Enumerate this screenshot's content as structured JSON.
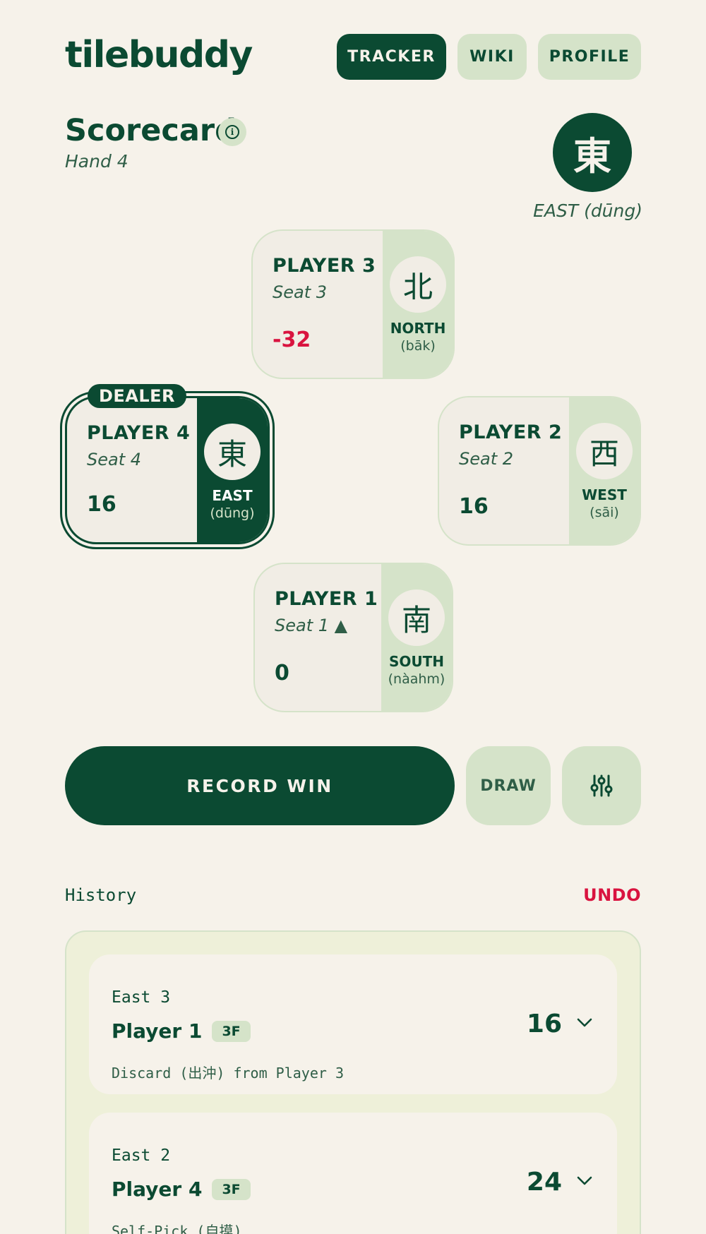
{
  "header": {
    "logo": "tilebuddy",
    "nav": [
      {
        "label": "TRACKER",
        "active": true
      },
      {
        "label": "WIKI",
        "active": false
      },
      {
        "label": "PROFILE",
        "active": false
      }
    ]
  },
  "scorecard": {
    "title": "Scorecard",
    "info_icon": "info-icon",
    "hand": "Hand 4",
    "prevailing_wind": {
      "tile": "東",
      "label": "EAST (dūng)"
    }
  },
  "players": {
    "top": {
      "name": "PLAYER 3",
      "seat": "Seat 3",
      "score": "-32",
      "tile": "北",
      "wind": "NORTH",
      "romanization": "(bāk)"
    },
    "left": {
      "name": "PLAYER 4",
      "seat": "Seat 4",
      "score": "16",
      "tile": "東",
      "wind": "EAST",
      "romanization": "(dūng)",
      "badge": "DEALER"
    },
    "right": {
      "name": "PLAYER 2",
      "seat": "Seat 2",
      "score": "16",
      "tile": "西",
      "wind": "WEST",
      "romanization": "(sāi)"
    },
    "bottom": {
      "name": "PLAYER 1",
      "seat": "Seat 1 ▲",
      "score": "0",
      "tile": "南",
      "wind": "SOUTH",
      "romanization": "(nàahm)"
    }
  },
  "actions": {
    "record_win": "RECORD WIN",
    "draw": "DRAW",
    "settings_icon": "sliders-icon"
  },
  "history": {
    "title": "History",
    "undo": "UNDO",
    "items": [
      {
        "round": "East 3",
        "winner": "Player 1",
        "fan": "3F",
        "detail": "Discard (出沖) from Player 3",
        "amount": "16"
      },
      {
        "round": "East 2",
        "winner": "Player 4",
        "fan": "3F",
        "detail": "Self-Pick (自摸)",
        "amount": "24"
      }
    ]
  },
  "colors": {
    "primary": "#0b4a32",
    "accent_light": "#d5e3c9",
    "background": "#f6f2ea",
    "negative": "#d9133f"
  }
}
